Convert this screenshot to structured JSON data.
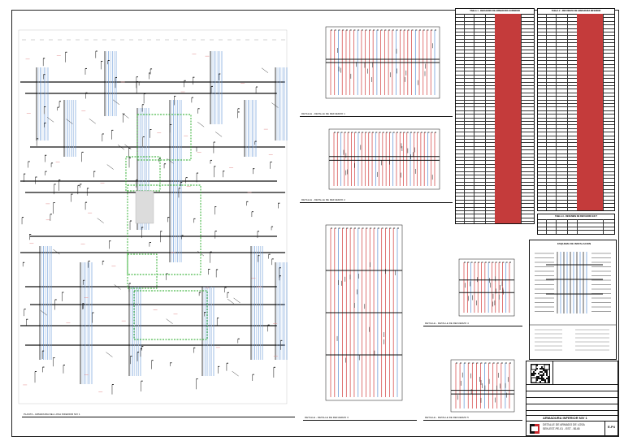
{
  "sheet": {
    "main_plan_caption": "PLANTA - ARMADURA DEL LOSA INFERIOR NIV 1",
    "detail_captions": [
      "DETALLE - DETALLE DE REFUERZO 1",
      "DETALLE - DETALLE DE REFUERZO 2",
      "DETALLE - DETALLE DE REFUERZO 3",
      "DETALLE - DETALLE DE REFUERZO 4",
      "DETALLE - DETALLE DE REFUERZO 5"
    ]
  },
  "schedules": {
    "left_title": "TABLA 1 - REFUERZO DE ARMADURA SUPERIOR",
    "right_title": "TABLA 2 - REFUERZO DE ARMADURA INFERIOR",
    "summary_title": "TABLA 3 - RESUMEN DE REFUERZO EN T"
  },
  "legend": {
    "title": "ESQUEMA DE INSTALACION"
  },
  "title_block": {
    "project": "ARMADURA INFERIOR NIV 1",
    "drawing_title_1": "DETALLE DE ARMADO DE LOSA",
    "drawing_title_2": "SEN-EST-PE-01 - EST - B145",
    "sheet_number": "E-P4"
  },
  "colors": {
    "rebar_red": "#d23c3c",
    "rebar_blue": "#5b8fd4",
    "zone_green": "#22aa22",
    "ink": "#111111"
  }
}
